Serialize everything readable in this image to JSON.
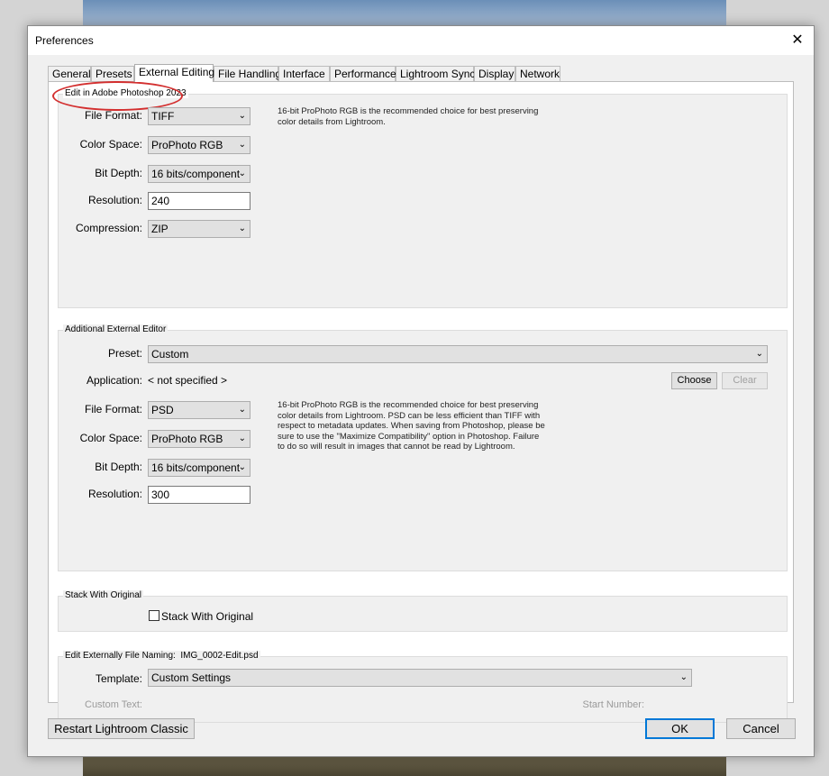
{
  "window": {
    "title": "Preferences",
    "close_icon": "close-icon"
  },
  "tabs": [
    "General",
    "Presets",
    "External Editing",
    "File Handling",
    "Interface",
    "Performance",
    "Lightroom Sync",
    "Display",
    "Network"
  ],
  "active_tab": "External Editing",
  "photoshop": {
    "legend": "Edit in Adobe Photoshop 2023",
    "file_format_label": "File Format:",
    "file_format": "TIFF",
    "color_space_label": "Color Space:",
    "color_space": "ProPhoto RGB",
    "bit_depth_label": "Bit Depth:",
    "bit_depth": "16 bits/component",
    "resolution_label": "Resolution:",
    "resolution": "240",
    "compression_label": "Compression:",
    "compression": "ZIP",
    "note": "16-bit ProPhoto RGB is the recommended choice for best preserving color details from Lightroom."
  },
  "additional": {
    "legend": "Additional External Editor",
    "preset_label": "Preset:",
    "preset": "Custom",
    "application_label": "Application:",
    "application": "< not specified >",
    "choose_button": "Choose",
    "clear_button": "Clear",
    "file_format_label": "File Format:",
    "file_format": "PSD",
    "color_space_label": "Color Space:",
    "color_space": "ProPhoto RGB",
    "bit_depth_label": "Bit Depth:",
    "bit_depth": "16 bits/component",
    "resolution_label": "Resolution:",
    "resolution": "300",
    "note": "16-bit ProPhoto RGB is the recommended choice for best preserving color details from Lightroom. PSD can be less efficient than TIFF with respect to metadata updates. When saving from Photoshop, please be sure to use the \"Maximize Compatibility\" option in Photoshop. Failure to do so will result in images that cannot be read by Lightroom."
  },
  "stack": {
    "legend": "Stack With Original",
    "checkbox_label": "Stack With Original",
    "checked": false
  },
  "naming": {
    "legend": "Edit Externally File Naming:",
    "example": "IMG_0002-Edit.psd",
    "template_label": "Template:",
    "template": "Custom Settings",
    "custom_text_label": "Custom Text:",
    "start_number_label": "Start Number:"
  },
  "footer": {
    "restart_button": "Restart Lightroom Classic",
    "ok_button": "OK",
    "cancel_button": "Cancel"
  },
  "colors": {
    "highlight_ellipse": "#d32f2f",
    "focus_border": "#0078d7"
  }
}
